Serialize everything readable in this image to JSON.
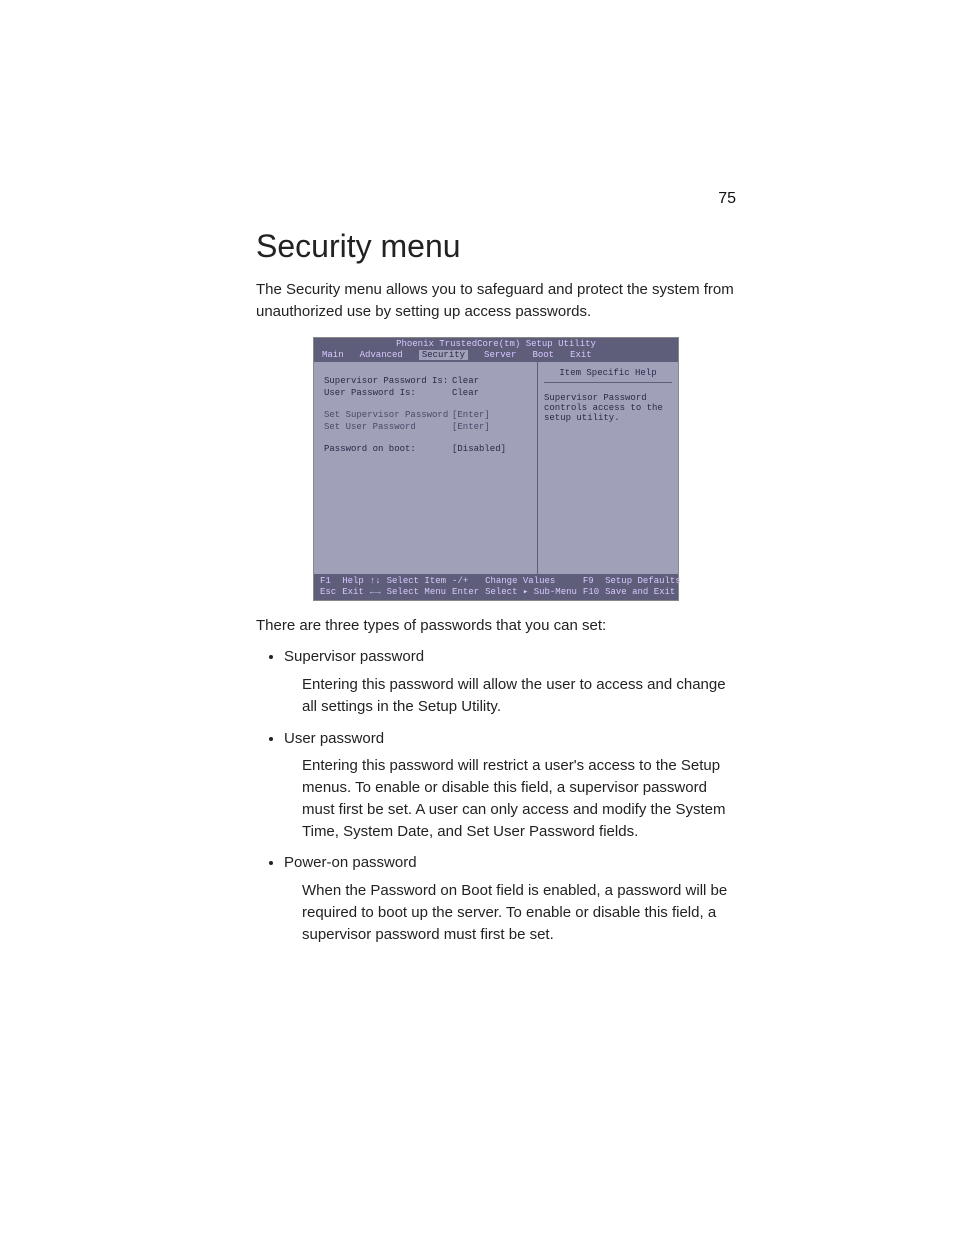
{
  "page_number": "75",
  "heading": "Security menu",
  "intro": "The Security menu allows you to safeguard and protect the system from unauthorized use by setting up access passwords.",
  "lead_list": "There are three types of passwords that you can set:",
  "list": [
    {
      "title": "Supervisor password",
      "body": "Entering this password will allow the user to access and change all settings in the Setup Utility."
    },
    {
      "title": "User password",
      "body": "Entering this password will restrict a user's access to the Setup menus.  To enable or disable this field, a supervisor password must first be set.  A user can only access and modify the System Time, System Date, and Set User Password fields."
    },
    {
      "title": "Power-on password",
      "body": "When the Password on Boot field is enabled, a password will be required to boot up the server.  To enable or disable this field, a supervisor password must first be set."
    }
  ],
  "bios": {
    "title": "Phoenix TrustedCore(tm) Setup Utility",
    "tabs": [
      "Main",
      "Advanced",
      "Security",
      "Server",
      "Boot",
      "Exit"
    ],
    "active_tab": "Security",
    "rows": [
      {
        "label": "Supervisor Password Is:",
        "value": "Clear",
        "action": false
      },
      {
        "label": "User Password Is:",
        "value": "Clear",
        "action": false
      },
      {
        "spacer": true
      },
      {
        "label": "Set Supervisor Password",
        "value": "[Enter]",
        "action": true
      },
      {
        "label": "Set User Password",
        "value": "[Enter]",
        "action": true
      },
      {
        "spacer": true
      },
      {
        "label": "Password on boot:",
        "value": "[Disabled]",
        "action": false
      }
    ],
    "help": {
      "title": "Item Specific Help",
      "text": "Supervisor Password controls access to the setup utility."
    },
    "footer": {
      "f1": {
        "key": "F1",
        "label": "Help"
      },
      "ud": {
        "key": "↑↓",
        "label": "Select Item"
      },
      "pm": {
        "key": "-/+",
        "label": "Change Values"
      },
      "f9": {
        "key": "F9",
        "label": "Setup Defaults"
      },
      "esc": {
        "key": "Esc",
        "label": "Exit"
      },
      "lr": {
        "key": "←→",
        "label": "Select Menu"
      },
      "enter": {
        "key": "Enter",
        "label": "Select ▸ Sub-Menu"
      },
      "f10": {
        "key": "F10",
        "label": "Save and Exit"
      }
    }
  }
}
